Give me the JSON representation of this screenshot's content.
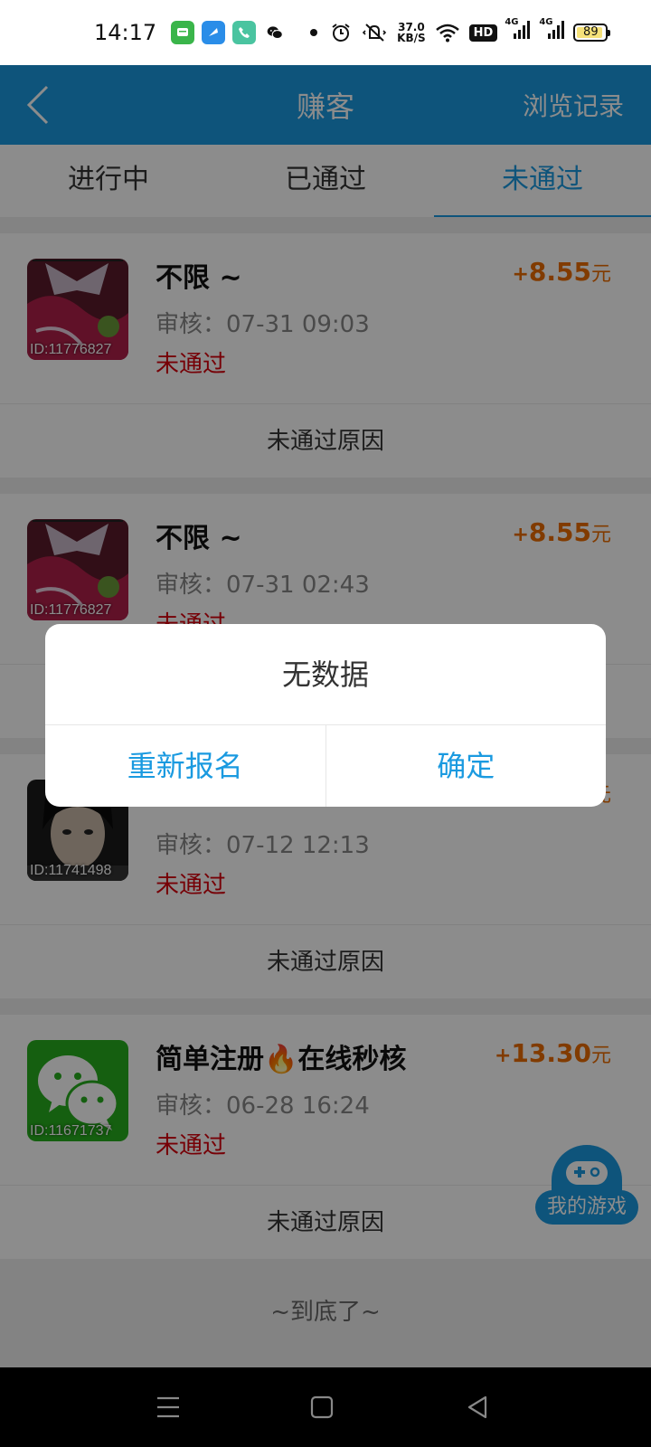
{
  "status_bar": {
    "time": "14:17",
    "net_speed_value": "37.0",
    "net_speed_unit": "KB/S",
    "hd_label": "HD",
    "signal1_label": "4G",
    "signal2_label": "4G",
    "battery_level": "89",
    "icons": [
      "messages-app-icon",
      "browser-app-icon",
      "phone-app-icon",
      "wechat-icon",
      "notification-dot",
      "alarm-icon",
      "vibrate-icon",
      "wifi-icon"
    ]
  },
  "header": {
    "title": "赚客",
    "history_label": "浏览记录"
  },
  "tabs": [
    {
      "label": "进行中",
      "active": false
    },
    {
      "label": "已通过",
      "active": false
    },
    {
      "label": "未通过",
      "active": true
    }
  ],
  "cards": [
    {
      "title": "不限 ~",
      "reward_sign": "+",
      "reward_amount": "8.55",
      "reward_unit": "元",
      "review": "审核：07-31 09:03",
      "status": "未通过",
      "thumb_id": "ID:11776827",
      "reason_label": "未通过原因"
    },
    {
      "title": "不限 ~",
      "reward_sign": "+",
      "reward_amount": "8.55",
      "reward_unit": "元",
      "review": "审核：07-31 02:43",
      "status": "未通过",
      "thumb_id": "ID:11776827",
      "reason_label": ""
    },
    {
      "title": "",
      "reward_sign": "",
      "reward_amount": "",
      "reward_unit": "元",
      "review": "审核：07-12 12:13",
      "status": "未通过",
      "thumb_id": "ID:11741498",
      "reason_label": "未通过原因"
    },
    {
      "title": "简单注册🔥在线秒核",
      "reward_sign": "+",
      "reward_amount": "13.30",
      "reward_unit": "元",
      "review": "审核：06-28 16:24",
      "status": "未通过",
      "thumb_id": "ID:11671737",
      "reason_label": "未通过原因"
    }
  ],
  "list_end": "~到底了~",
  "game_button": {
    "label": "我的游戏"
  },
  "dialog": {
    "message": "无数据",
    "buttons": [
      "重新报名",
      "确定"
    ]
  },
  "colors": {
    "primary": "#1a9ae0",
    "reward": "#ec6c00",
    "status_failed": "#d8000c"
  }
}
